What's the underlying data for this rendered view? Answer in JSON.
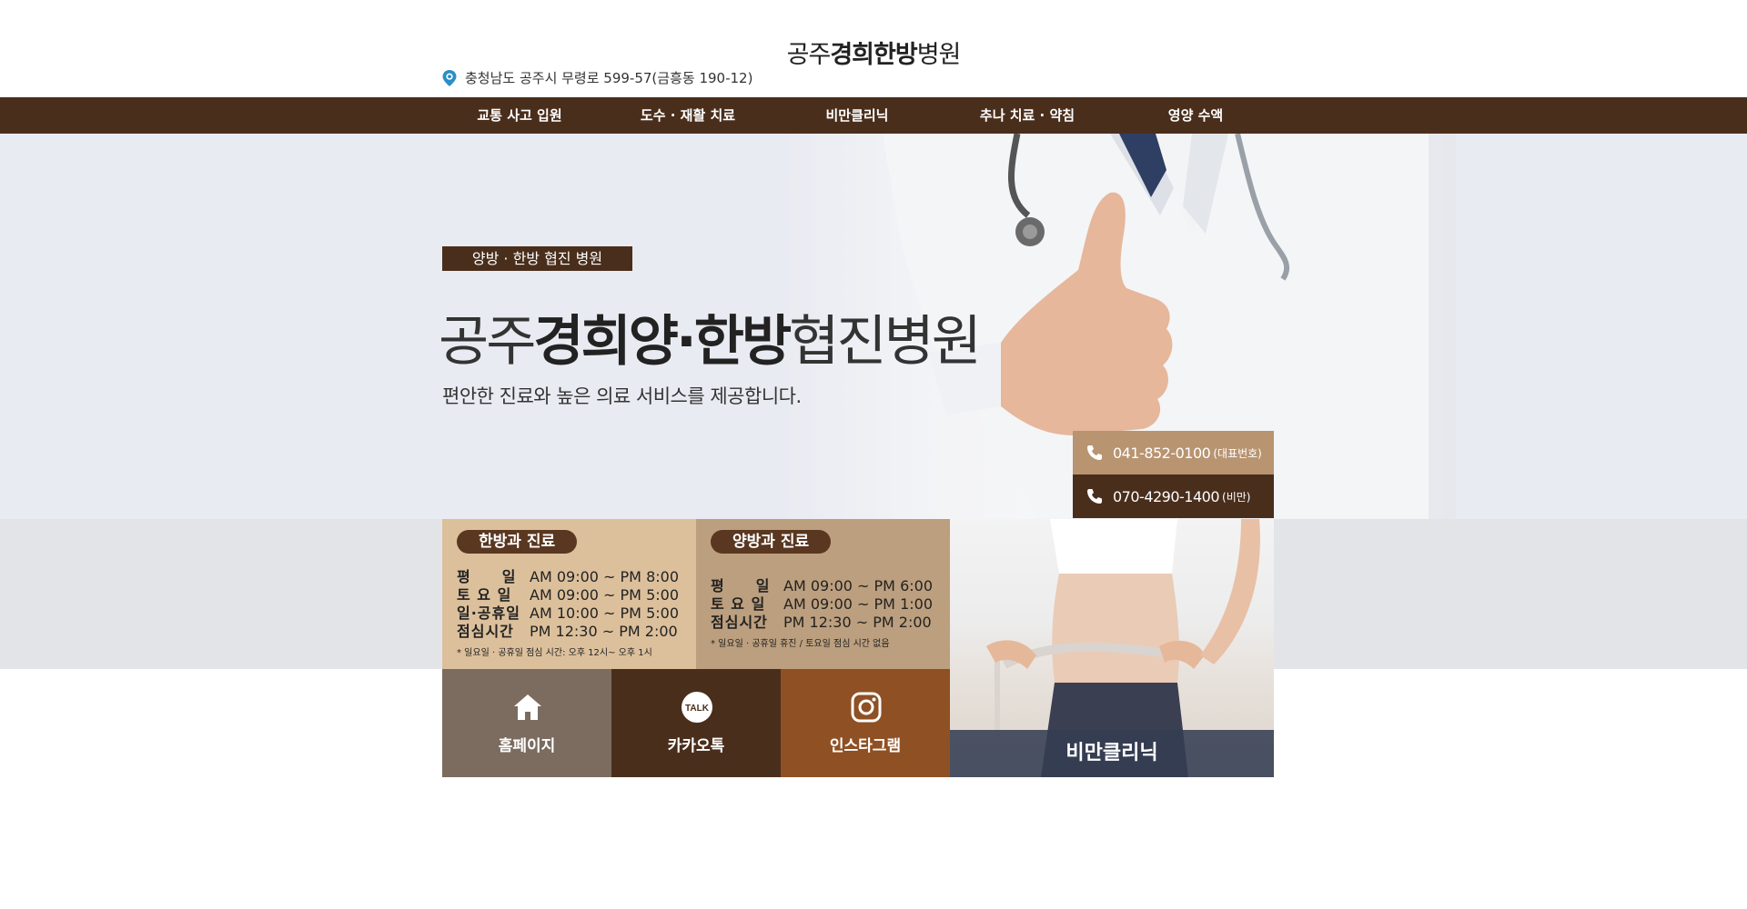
{
  "header": {
    "logo_prefix": "공주",
    "logo_bold": "경희한방",
    "logo_suffix": "병원",
    "address": "충청남도 공주시 무령로 599-57(금흥동 190-12)",
    "address_icon": "location-pin-icon"
  },
  "nav": {
    "items": [
      {
        "label": "교통 사고 입원"
      },
      {
        "label": "도수 · 재활 치료"
      },
      {
        "label": "비만클리닉"
      },
      {
        "label": "추나 치료 · 약침"
      },
      {
        "label": "영양 수액"
      }
    ]
  },
  "hero": {
    "tag": "양방 · 한방 협진 병원",
    "title_prefix": "공주",
    "title_bold": "경희양·한방",
    "title_suffix": "협진병원",
    "subtitle": "편안한 진료와 높은 의료 서비스를 제공합니다.",
    "phones": [
      {
        "number": "041-852-0100",
        "note": "(대표번호)",
        "icon": "phone-icon"
      },
      {
        "number": "070-4290-1400",
        "note": "(비만)",
        "icon": "phone-icon"
      }
    ]
  },
  "hours": {
    "hanbang": {
      "title": "한방과 진료",
      "rows": [
        {
          "label": "평　　일",
          "time": "AM 09:00 ~ PM 8:00"
        },
        {
          "label": "토 요 일",
          "time": "AM 09:00 ~ PM 5:00"
        },
        {
          "label": "일·공휴일",
          "time": "AM 10:00 ~ PM 5:00"
        },
        {
          "label": "점심시간",
          "time": "PM 12:30 ~ PM 2:00"
        }
      ],
      "note": "* 일요일 · 공휴일 점심 시간: 오후 12시~ 오후 1시"
    },
    "yangbang": {
      "title": "양방과 진료",
      "rows": [
        {
          "label": "평　　일",
          "time": "AM 09:00 ~ PM 6:00"
        },
        {
          "label": "토 요 일",
          "time": "AM 09:00 ~ PM 1:00"
        },
        {
          "label": "점심시간",
          "time": "PM 12:30 ~ PM 2:00"
        }
      ],
      "note": "* 일요일 · 공휴일 휴진 / 토요일 점심 시간 없음"
    }
  },
  "links": {
    "home": {
      "label": "홈페이지",
      "icon": "home-icon"
    },
    "kakao": {
      "label": "카카오톡",
      "icon": "kakao-talk-icon",
      "icon_text": "TALK"
    },
    "instagram": {
      "label": "인스타그램",
      "icon": "instagram-icon"
    }
  },
  "diet": {
    "label": "비만클리닉"
  },
  "colors": {
    "brown_dark": "#4a2e1c",
    "tan": "#b89470",
    "beige": "#dcc09c",
    "orange_brown": "#8f5023",
    "taupe": "#7b6c5f"
  }
}
